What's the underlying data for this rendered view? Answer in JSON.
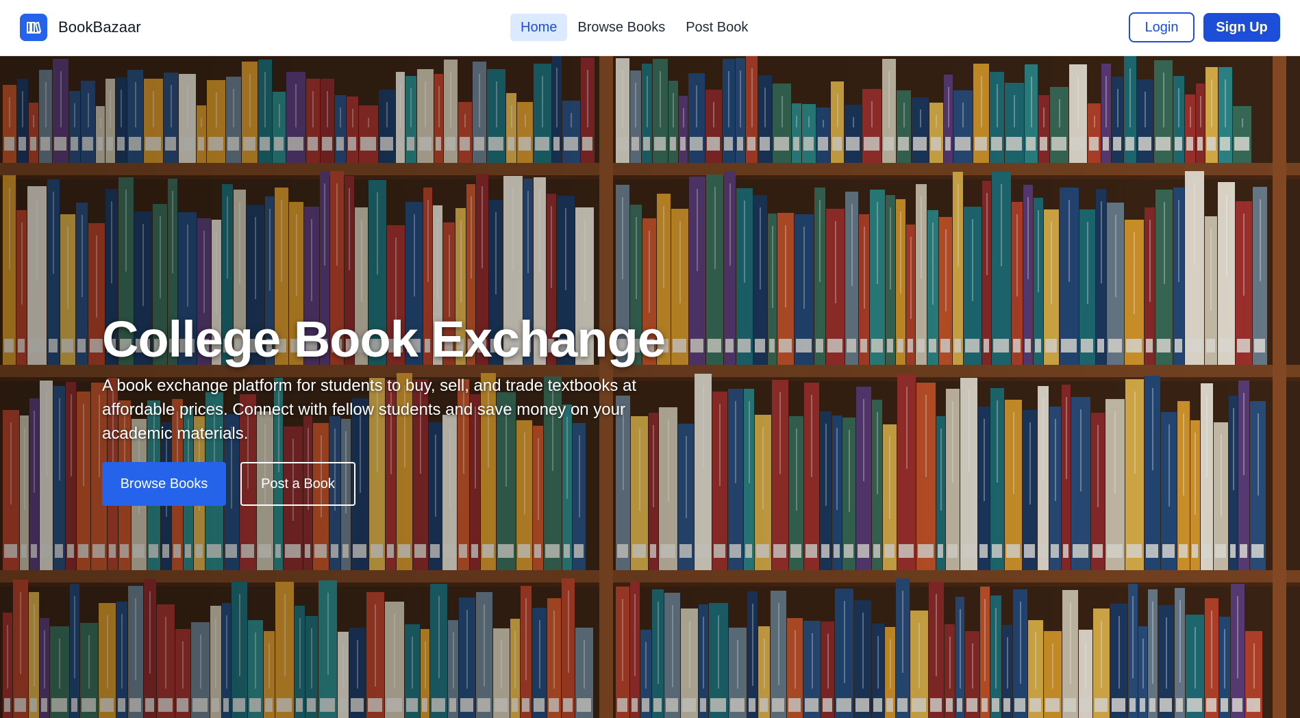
{
  "brand": {
    "name": "BookBazaar",
    "logo_icon": "book-library-icon",
    "accent": "#2563eb"
  },
  "nav": {
    "links": [
      {
        "label": "Home",
        "active": true
      },
      {
        "label": "Browse Books",
        "active": false
      },
      {
        "label": "Post Book",
        "active": false
      }
    ],
    "login_label": "Login",
    "signup_label": "Sign Up"
  },
  "hero": {
    "title": "College Book Exchange",
    "description": "A book exchange platform for students to buy, sell, and trade textbooks at affordable prices. Connect with fellow students and save money on your academic materials.",
    "primary_button": "Browse Books",
    "secondary_button": "Post a Book",
    "background": "bookshelf-photo"
  }
}
